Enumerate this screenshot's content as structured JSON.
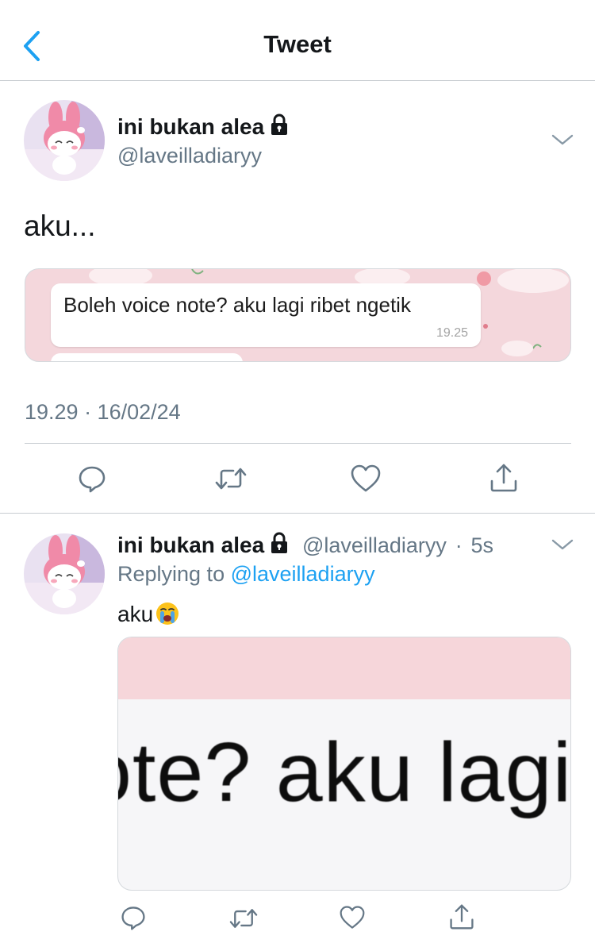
{
  "header": {
    "title": "Tweet"
  },
  "main_tweet": {
    "display_name": "ini bukan alea",
    "handle": "@laveilladiaryy",
    "text": "aku...",
    "media": {
      "bubble_text": "Boleh voice note? aku lagi ribet ngetik",
      "bubble_time": "19.25"
    },
    "timestamp": "19.29 · 16/02/24"
  },
  "reply_tweet": {
    "display_name": "ini bukan alea",
    "handle": "@laveilladiaryy",
    "separator": "·",
    "time_ago": "5s",
    "replying_prefix": "Replying to",
    "replying_to": "@laveilladiaryy",
    "text": "aku",
    "media": {
      "zoomed_text": "ote? aku lagi"
    }
  },
  "icons": {
    "back": "chevron-left-icon",
    "lock": "lock-icon",
    "caret": "chevron-down-icon",
    "reply": "reply-icon",
    "retweet": "retweet-icon",
    "like": "heart-icon",
    "share": "share-icon",
    "emoji": "loudly-crying-face-icon"
  },
  "colors": {
    "accent": "#1da1f2",
    "secondary_text": "#657786",
    "icon_gray": "#657786",
    "divider": "#c8ccd1"
  }
}
